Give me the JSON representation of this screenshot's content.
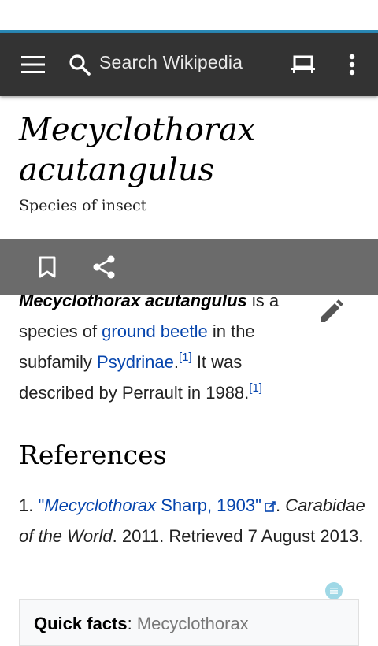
{
  "toolbar": {
    "search_placeholder": "Search Wikipedia"
  },
  "article": {
    "title_line1": "Mecyclothorax",
    "title_line2": "acutangulus",
    "description": "Species of insect",
    "lead_bold": "Mecyclothorax acutangulus",
    "lead_t1": " is a species of ",
    "link_ground_beetle": "ground beetle",
    "lead_t2": " in the subfamily ",
    "link_psydrinae": "Psydrinae",
    "lead_t3": ".",
    "cite1": "[1]",
    "lead_t4": " It was described by Perrault in 1988.",
    "cite2": "[1]"
  },
  "references": {
    "heading": "References",
    "item_number": "1.",
    "item_link_open": "\"",
    "item_link_italic": "Mecyclothorax",
    "item_link_rest": " Sharp, 1903\"",
    "item_after_link": ".",
    "item_source": "Carabidae of the World",
    "item_rest": ". 2011. Retrieved 7 August 2013."
  },
  "quick_facts": {
    "label": "Quick facts",
    "separator": ": ",
    "value": "Mecyclothorax"
  },
  "colors": {
    "toolbar": "#333333",
    "accent": "#2a88b5",
    "action_bar": "#6b6b6b",
    "link": "#0645ad"
  },
  "icons": [
    "menu-icon",
    "search-icon",
    "reading-list-icon",
    "overflow-menu-icon",
    "bookmark-icon",
    "share-icon",
    "edit-pencil-icon",
    "external-link-icon",
    "floating-contents-icon"
  ]
}
